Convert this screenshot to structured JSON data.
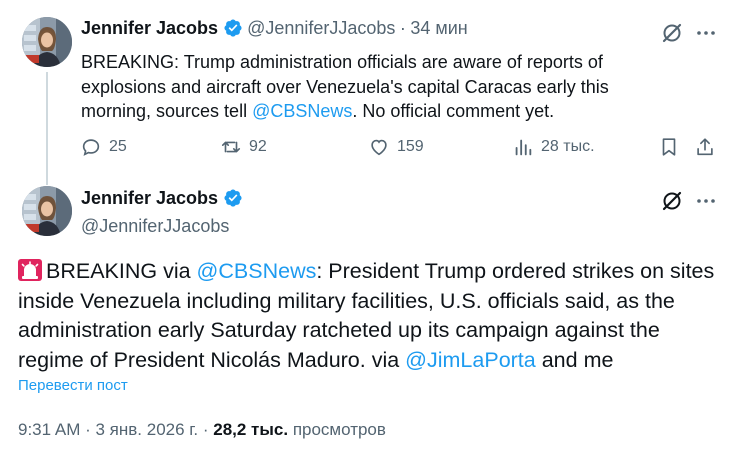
{
  "tweet1": {
    "author_name": "Jennifer Jacobs",
    "handle": "@JenniferJJacobs",
    "separator": "·",
    "time": "34 мин",
    "text_before": "BREAKING: Trump administration officials are aware of reports of explosions and aircraft over Venezuela's capital Caracas early this morning, sources tell ",
    "mention": "@CBSNews",
    "text_after": ". No official comment yet.",
    "replies": "25",
    "reposts": "92",
    "likes": "159",
    "views": "28 тыс."
  },
  "tweet2": {
    "author_name": "Jennifer Jacobs",
    "handle": "@JenniferJJacobs",
    "text_part1": "BREAKING via ",
    "mention1": "@CBSNews",
    "text_part2": ": President Trump ordered strikes on sites inside Venezuela including military facilities, U.S. officials said, as the administration early Saturday ratcheted up its campaign against the regime of President Nicolás Maduro. via ",
    "mention2": "@JimLaPorta",
    "text_part3": " and me",
    "translate_label": "Перевести пост",
    "time": "9:31 AM",
    "date": "3 янв. 2026 г.",
    "views_count": "28,2 тыс.",
    "views_label": "просмотров"
  },
  "colors": {
    "accent": "#1d9bf0",
    "secondary_text": "#536471",
    "primary_text": "#0f1419"
  },
  "icons": [
    "verified-badge-icon",
    "grok-icon",
    "more-icon",
    "reply-icon",
    "repost-icon",
    "like-icon",
    "analytics-icon",
    "bookmark-icon",
    "share-icon",
    "siren-icon"
  ]
}
